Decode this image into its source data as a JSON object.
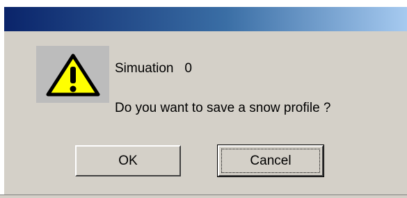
{
  "dialog": {
    "message_line1": "Simuation   0",
    "message_line2": "Do you want to save a snow profile ?",
    "icon": "warning-icon"
  },
  "buttons": {
    "ok_label": "OK",
    "cancel_label": "Cancel"
  },
  "colors": {
    "titlebar_start": "#0a246a",
    "titlebar_end": "#a6caf0",
    "face": "#d4d0c8",
    "warning_yellow": "#ffff00"
  }
}
